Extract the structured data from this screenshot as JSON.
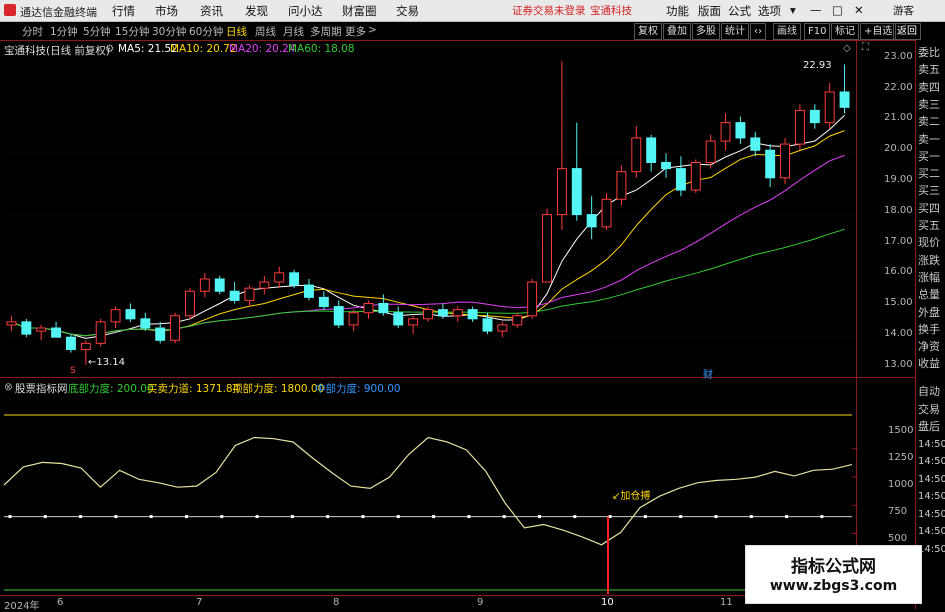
{
  "titlebar": {
    "app_name": "通达信金融终端",
    "menus": [
      "行情",
      "市场",
      "资讯",
      "发现",
      "问小达",
      "财富圈",
      "交易"
    ],
    "notice": "证券交易未登录",
    "stock": "宝通科技",
    "right_menus": [
      "功能",
      "版面",
      "公式",
      "选项"
    ],
    "guest": "游客"
  },
  "periods": [
    "分时",
    "1分钟",
    "5分钟",
    "15分钟",
    "30分钟",
    "60分钟",
    "日线",
    "周线",
    "月线",
    "多周期",
    "更多"
  ],
  "active_period": "日线",
  "toolbar": [
    "复权",
    "叠加",
    "多股",
    "统计",
    "画线",
    "F10",
    "标记",
    "+自选",
    "返回"
  ],
  "main_chart": {
    "header": "宝通科技(日线 前复权)",
    "ma": [
      {
        "label": "MA5: 21.52",
        "color": "#ffffff"
      },
      {
        "label": "MA10: 20.72",
        "color": "#ffd700"
      },
      {
        "label": "MA20: 20.24",
        "color": "#e040fb"
      },
      {
        "label": "MA60: 18.08",
        "color": "#33cc33"
      }
    ],
    "high_label": "22.93",
    "low_label": "13.14",
    "marker": "财",
    "y_ticks": [
      "23.00",
      "22.00",
      "21.00",
      "20.00",
      "19.00",
      "18.00",
      "17.00",
      "16.00",
      "15.00",
      "14.00",
      "13.00"
    ]
  },
  "indicator": {
    "name": "股票指标网",
    "items": [
      {
        "label": "底部力度: 200.00",
        "color": "#33cc33"
      },
      {
        "label": "买卖力道: 1371.84",
        "color": "#ffd700"
      },
      {
        "label": "顶部力度: 1800.00",
        "color": "#ffd700"
      },
      {
        "label": "中部力度: 900.00",
        "color": "#3399ff"
      }
    ],
    "signal": "加仓搏",
    "y_ticks": [
      "1500",
      "1250",
      "1000",
      "750",
      "500"
    ]
  },
  "x_axis": [
    "2024年",
    "6",
    "7",
    "8",
    "9",
    "10",
    "11"
  ],
  "right_panel": {
    "top": [
      "委比",
      "卖五",
      "卖四",
      "卖三",
      "卖二",
      "卖一",
      "买一",
      "买二",
      "买三",
      "买四",
      "买五",
      "现价",
      "涨跌",
      "涨幅",
      "总量",
      "外盘",
      "换手",
      "净资",
      "收益"
    ],
    "bottom": [
      "自动",
      "交易",
      "盘后",
      "14:50",
      "14:50",
      "14:50",
      "14:50",
      "14:50",
      "14:50",
      "14:50"
    ]
  },
  "watermark": {
    "line1": "指标公式网",
    "line2": "www.zbgs3.com"
  },
  "chart_data": {
    "type": "candlestick",
    "title": "宝通科技(日线 前复权)",
    "ylim": [
      12.8,
      23.5
    ],
    "candles_ohlc_sampled": [
      [
        14.4,
        14.7,
        14.2,
        14.5
      ],
      [
        14.5,
        14.6,
        14.0,
        14.1
      ],
      [
        14.2,
        14.4,
        13.9,
        14.3
      ],
      [
        14.3,
        14.5,
        14.0,
        14.0
      ],
      [
        14.0,
        14.1,
        13.5,
        13.6
      ],
      [
        13.6,
        13.9,
        13.1,
        13.8
      ],
      [
        13.8,
        14.6,
        13.7,
        14.5
      ],
      [
        14.5,
        15.0,
        14.3,
        14.9
      ],
      [
        14.9,
        15.1,
        14.5,
        14.6
      ],
      [
        14.6,
        14.8,
        14.2,
        14.3
      ],
      [
        14.3,
        14.5,
        13.8,
        13.9
      ],
      [
        13.9,
        14.8,
        13.8,
        14.7
      ],
      [
        14.7,
        15.6,
        14.6,
        15.5
      ],
      [
        15.5,
        16.1,
        15.3,
        15.9
      ],
      [
        15.9,
        16.0,
        15.4,
        15.5
      ],
      [
        15.5,
        15.8,
        15.1,
        15.2
      ],
      [
        15.2,
        15.7,
        15.0,
        15.6
      ],
      [
        15.6,
        16.0,
        15.4,
        15.8
      ],
      [
        15.8,
        16.3,
        15.6,
        16.1
      ],
      [
        16.1,
        16.2,
        15.6,
        15.7
      ],
      [
        15.7,
        15.9,
        15.2,
        15.3
      ],
      [
        15.3,
        15.5,
        14.9,
        15.0
      ],
      [
        15.0,
        15.2,
        14.3,
        14.4
      ],
      [
        14.4,
        14.9,
        14.2,
        14.8
      ],
      [
        14.8,
        15.2,
        14.6,
        15.1
      ],
      [
        15.1,
        15.4,
        14.7,
        14.8
      ],
      [
        14.8,
        15.0,
        14.3,
        14.4
      ],
      [
        14.4,
        14.7,
        14.1,
        14.6
      ],
      [
        14.6,
        15.0,
        14.5,
        14.9
      ],
      [
        14.9,
        15.1,
        14.6,
        14.7
      ],
      [
        14.7,
        15.0,
        14.5,
        14.9
      ],
      [
        14.9,
        15.0,
        14.5,
        14.6
      ],
      [
        14.6,
        14.8,
        14.1,
        14.2
      ],
      [
        14.2,
        14.5,
        14.0,
        14.4
      ],
      [
        14.4,
        14.8,
        14.3,
        14.7
      ],
      [
        14.7,
        15.9,
        14.6,
        15.8
      ],
      [
        15.8,
        18.2,
        15.8,
        18.0
      ],
      [
        18.0,
        23.0,
        17.5,
        19.5
      ],
      [
        19.5,
        21.0,
        17.8,
        18.0
      ],
      [
        18.0,
        18.6,
        17.2,
        17.6
      ],
      [
        17.6,
        18.7,
        17.5,
        18.5
      ],
      [
        18.5,
        19.6,
        18.3,
        19.4
      ],
      [
        19.4,
        20.9,
        19.2,
        20.5
      ],
      [
        20.5,
        20.6,
        19.4,
        19.7
      ],
      [
        19.7,
        20.0,
        19.2,
        19.5
      ],
      [
        19.5,
        19.9,
        18.6,
        18.8
      ],
      [
        18.8,
        19.8,
        18.7,
        19.7
      ],
      [
        19.7,
        20.6,
        19.5,
        20.4
      ],
      [
        20.4,
        21.3,
        20.1,
        21.0
      ],
      [
        21.0,
        21.2,
        20.3,
        20.5
      ],
      [
        20.5,
        20.7,
        19.9,
        20.1
      ],
      [
        20.1,
        20.3,
        18.9,
        19.2
      ],
      [
        19.2,
        20.5,
        19.0,
        20.3
      ],
      [
        20.3,
        21.6,
        20.1,
        21.4
      ],
      [
        21.4,
        21.6,
        20.8,
        21.0
      ],
      [
        21.0,
        22.3,
        20.8,
        22.0
      ],
      [
        22.0,
        22.9,
        21.3,
        21.5
      ]
    ],
    "indicator_series": {
      "name": "买卖力道",
      "values_sampled": [
        1180,
        1340,
        1380,
        1370,
        1330,
        1160,
        1310,
        1230,
        1200,
        1160,
        1170,
        1290,
        1530,
        1600,
        1590,
        1560,
        1420,
        1290,
        1170,
        1150,
        1250,
        1450,
        1600,
        1560,
        1490,
        1300,
        1020,
        800,
        830,
        780,
        720,
        650,
        760,
        980,
        1080,
        1150,
        1200,
        1220,
        1230,
        1250,
        1300,
        1260,
        1310,
        1320,
        1360
      ]
    },
    "levels": {
      "底部力度": 200,
      "顶部力度": 1800,
      "中部力度": 900
    }
  }
}
